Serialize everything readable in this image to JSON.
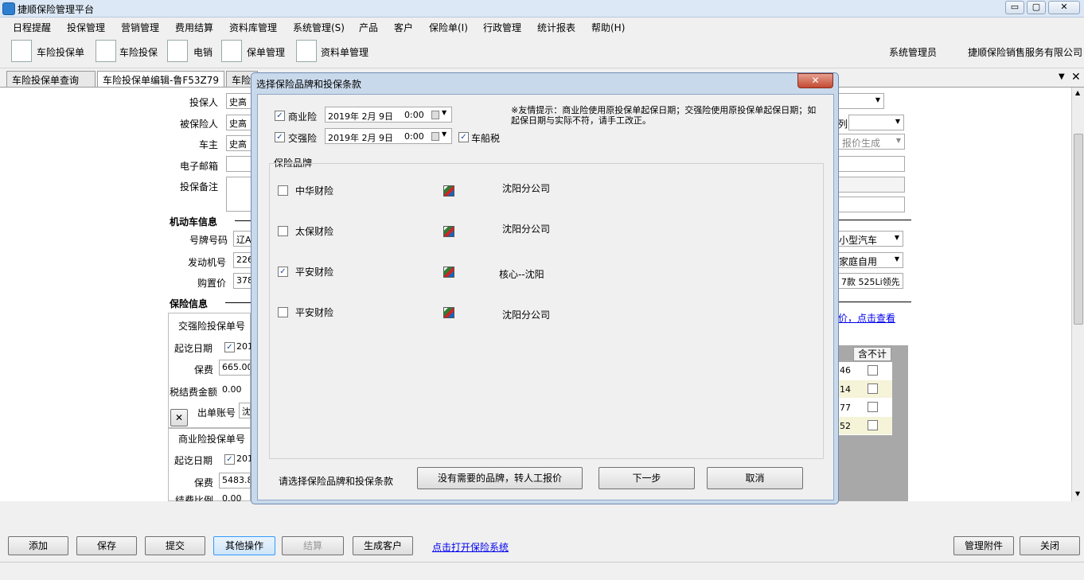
{
  "window": {
    "title": "捷顺保险管理平台",
    "min": "▭",
    "max": "▢",
    "close": "✕"
  },
  "menu": [
    "日程提醒",
    "投保管理",
    "营销管理",
    "费用结算",
    "资料库管理",
    "系统管理(S)",
    "产品",
    "客户",
    "保险单(I)",
    "行政管理",
    "统计报表",
    "帮助(H)"
  ],
  "toolbar": {
    "items": [
      "车险投保单",
      "车险投保",
      "电销",
      "保单管理",
      "资料单管理"
    ],
    "user": "系统管理员",
    "company": "捷顺保险销售服务有限公司"
  },
  "tabs": [
    "车险投保单查询",
    "车险投保单编辑-鲁F53Z79",
    "车险"
  ],
  "form": {
    "applicant_label": "投保人",
    "applicant": "史高",
    "insured_label": "被保险人",
    "insured": "史高",
    "owner_label": "车主",
    "owner": "史高",
    "email_label": "电子邮箱",
    "email": "",
    "remark_label": "投保备注",
    "remark": "",
    "vehicle_section": "机动车信息",
    "plate_label": "号牌号码",
    "plate": "辽A",
    "engine_label": "发动机号",
    "engine": "226",
    "price_label": "购置价",
    "price": "378",
    "insurance_section": "保险信息",
    "ci_no_label": "交强险投保单号",
    "ci_date_label": "起讫日期",
    "ci_date": "201",
    "ci_premium_label": "保费",
    "ci_premium": "665.00",
    "tax_label": "税结费金额",
    "tax": "0.00",
    "account_label": "出单账号",
    "account": "沈",
    "bi_no_label": "商业险投保单号",
    "bi_date_label": "起讫日期",
    "bi_date": "201",
    "bi_premium_label": "保费",
    "bi_premium": "5483.8",
    "ratio_label": "结费比例",
    "ratio": "0.00",
    "right_quote": "报价生成",
    "right_vehicle_type": "小型汽车",
    "right_usage": "家庭自用",
    "right_model": "7款 525Li领先",
    "right_link": "价，点击查看",
    "right_partial_label": "列",
    "grid_header": "含不计",
    "grid_values": [
      "46",
      "14",
      "77",
      "52"
    ]
  },
  "bottom": {
    "add": "添加",
    "save": "保存",
    "submit": "提交",
    "other": "其他操作",
    "settle": "结算",
    "gen_customer": "生成客户",
    "open_link": "点击打开保险系统",
    "attachments": "管理附件",
    "close": "关闭"
  },
  "dialog": {
    "title": "选择保险品牌和投保条款",
    "close": "✕",
    "commercial_label": "商业险",
    "commercial_date": "2019年 2月 9日",
    "commercial_time": "0:00",
    "compulsory_label": "交强险",
    "compulsory_date": "2019年 2月 9日",
    "compulsory_time": "0:00",
    "vehicle_tax_label": "车船税",
    "tip": "※友情提示：商业险使用原投保单起保日期；交强险使用原投保单起保日期；如起保日期与实际不符，请手工改正。",
    "brand_group": "保险品牌",
    "brands": [
      {
        "name": "中华财险",
        "branch": "沈阳分公司",
        "checked": false
      },
      {
        "name": "太保财险",
        "branch": "沈阳分公司",
        "checked": false
      },
      {
        "name": "平安财险",
        "branch": "核心--沈阳",
        "checked": true
      },
      {
        "name": "平安财险",
        "branch": "沈阳分公司",
        "checked": false
      }
    ],
    "footer_hint": "请选择保险品牌和投保条款",
    "manual_quote": "没有需要的品牌，转人工报价",
    "next": "下一步",
    "cancel": "取消"
  }
}
